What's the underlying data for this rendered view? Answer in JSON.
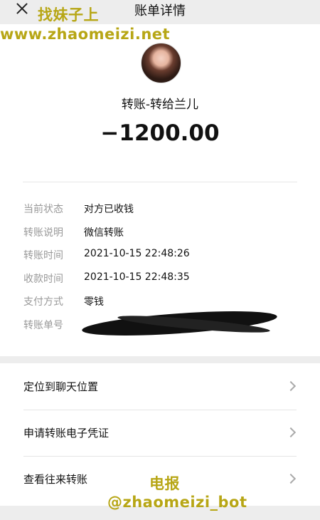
{
  "header": {
    "title": "账单详情",
    "close_icon": "close-icon"
  },
  "transaction": {
    "payee": "转账-转给兰儿",
    "amount": "−1200.00",
    "details": [
      {
        "label": "当前状态",
        "value": "对方已收钱"
      },
      {
        "label": "转账说明",
        "value": "微信转账"
      },
      {
        "label": "转账时间",
        "value": "2021-10-15 22:48:26"
      },
      {
        "label": "收款时间",
        "value": "2021-10-15 22:48:35"
      },
      {
        "label": "支付方式",
        "value": "零钱"
      },
      {
        "label": "转账单号",
        "value": ""
      }
    ]
  },
  "actions": [
    {
      "label": "定位到聊天位置"
    },
    {
      "label": "申请转账电子凭证"
    },
    {
      "label": "查看往来转账"
    }
  ],
  "watermarks": {
    "top": "找妹子上",
    "site": "www.zhaomeizi.net",
    "telegram": "电报",
    "bot": "@zhaomeizi_bot"
  }
}
